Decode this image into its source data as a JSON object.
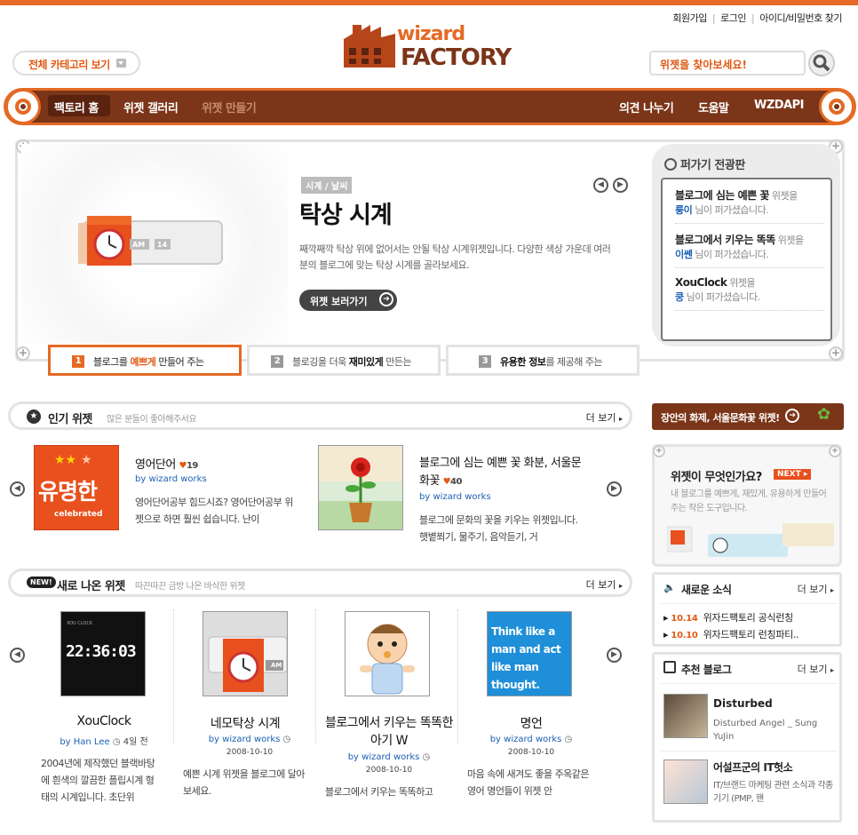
{
  "top_links": [
    "회원가입",
    "로그인",
    "아이디/비밀번호 찾기"
  ],
  "category_button": "전체 카테고리 보기",
  "logo": {
    "line1": "wizard",
    "line2": "FACTORY"
  },
  "search": {
    "placeholder": "위젯을 찾아보세요!"
  },
  "nav": {
    "left": [
      "팩토리 홈",
      "위젯 갤러리",
      "위젯 만들기"
    ],
    "right": [
      "의견 나누기",
      "도움말",
      "WZDAPI"
    ]
  },
  "hero": {
    "tag": "시계 / 날씨",
    "title": "탁상 시계",
    "description": "째깍째깍 탁상 위에 없어서는 안될 탁상 시계위젯입니다. 다양한 색상 가운데 여러분의 블로그에 맞는 탁상 시계를 골라보세요.",
    "button": "위젯 보러가기",
    "clock_labels": [
      "AM",
      "14"
    ]
  },
  "board": {
    "title": "퍼가기 전광판",
    "items": [
      {
        "widget": "블로그에 심는 예쁜 꽃",
        "suffix": " 위젯을",
        "user": "룽이",
        "tail": " 님이 퍼가셨습니다."
      },
      {
        "widget": "블로그에서 키우는 똑똑",
        "suffix": " 위젯을",
        "user": "이쎈",
        "tail": " 님이 퍼가셨습니다."
      },
      {
        "widget": "XouClock",
        "suffix": " 위젯을",
        "user": "쿵",
        "tail": " 님이 퍼가셨습니다."
      }
    ]
  },
  "tabs": [
    {
      "num": "1",
      "pre": "블로그를 ",
      "bold": "예쁘게",
      "post": " 만들어 주는"
    },
    {
      "num": "2",
      "pre": "블로깅을 더욱 ",
      "bold": "재미있게",
      "post": " 만든는"
    },
    {
      "num": "3",
      "pre": "",
      "bold": "유용한 정보",
      "post": "를 제공해 주는"
    }
  ],
  "popular": {
    "title": "인기 위젯",
    "subtitle": "많은 분들이 좋아해주서요",
    "more": "더 보기",
    "items": [
      {
        "title": "영어단어",
        "likes": "19",
        "by": "by wizard works",
        "desc": "영어단어공부 힘드시죠? 영어단어공부 위젯으로 하면 훨씬 쉽습니다. 난이",
        "thumb_text": "유명한",
        "thumb_sub": "celebrated"
      },
      {
        "title": "블로그에 심는 예쁜 꽃 화분, 서울문화꽃",
        "likes": "40",
        "by": "by wizard works",
        "desc": "블로그에 문화의 꽃을 키우는 위젯입니다. 햇볕쬐기, 물주기, 음악듣기, 거"
      }
    ]
  },
  "newest": {
    "badge": "NEW!",
    "title": "새로 나온 위젯",
    "subtitle": "따끈따끈 금방 나온 바삭한 위젯",
    "more": "더 보기",
    "items": [
      {
        "title": "XouClock",
        "by": "by Han Lee",
        "date": "4일 전",
        "desc": "2004년에 제작했던 블랙바탕에 흰색의 깔끔한 플립시계 형태의 시계입니다. 초단위",
        "thumb_digits": "22:36:03",
        "thumb_caption": "XOU CLOCK"
      },
      {
        "title": "네모탁상 시계",
        "by": "by wizard works",
        "date": "2008-10-10",
        "desc": "예쁜 시계 위젯을 블로그에 달아보세요.",
        "thumb_label": "AM"
      },
      {
        "title": "블로그에서 키우는 똑똑한 아기 W",
        "by": "by wizard works",
        "date": "2008-10-10",
        "desc": "블로그에서 키우는 똑똑하고"
      },
      {
        "title": "명언",
        "by": "by wizard works",
        "date": "2008-10-10",
        "desc": "마음 속에 새겨도 좋을 주옥같은 영어 명언들이 위젯 안",
        "thumb_text": "Think like a man and act like man thought."
      }
    ]
  },
  "side": {
    "banner": "장안의 화제, 서울문화꽃 위젯!",
    "what": {
      "title": "위젯이 무엇인가요?",
      "next": "NEXT",
      "desc": "내 블로그를 예쁘게, 재밌게, 유용하게 만들어 주는 작은 도구입니다."
    },
    "news": {
      "title": "새로운 소식",
      "more": "더 보기",
      "items": [
        {
          "date": "10.14",
          "text": "위자드팩토리 공식런칭"
        },
        {
          "date": "10.10",
          "text": "위자드팩토리 런칭파티.."
        }
      ]
    },
    "blogs": {
      "title": "추천 블로그",
      "more": "더 보기",
      "items": [
        {
          "name": "Disturbed",
          "desc": "Disturbed Angel _ Sung YuJin"
        },
        {
          "name": "어설프군의 IT헛소",
          "desc": "IT/브랜드 마케팅 관련 소식과 각종기기 (PMP, 핸"
        }
      ]
    }
  },
  "colors": {
    "accent": "#e46a25",
    "nav_bg": "#7b3518",
    "link": "#1c5fb5"
  }
}
